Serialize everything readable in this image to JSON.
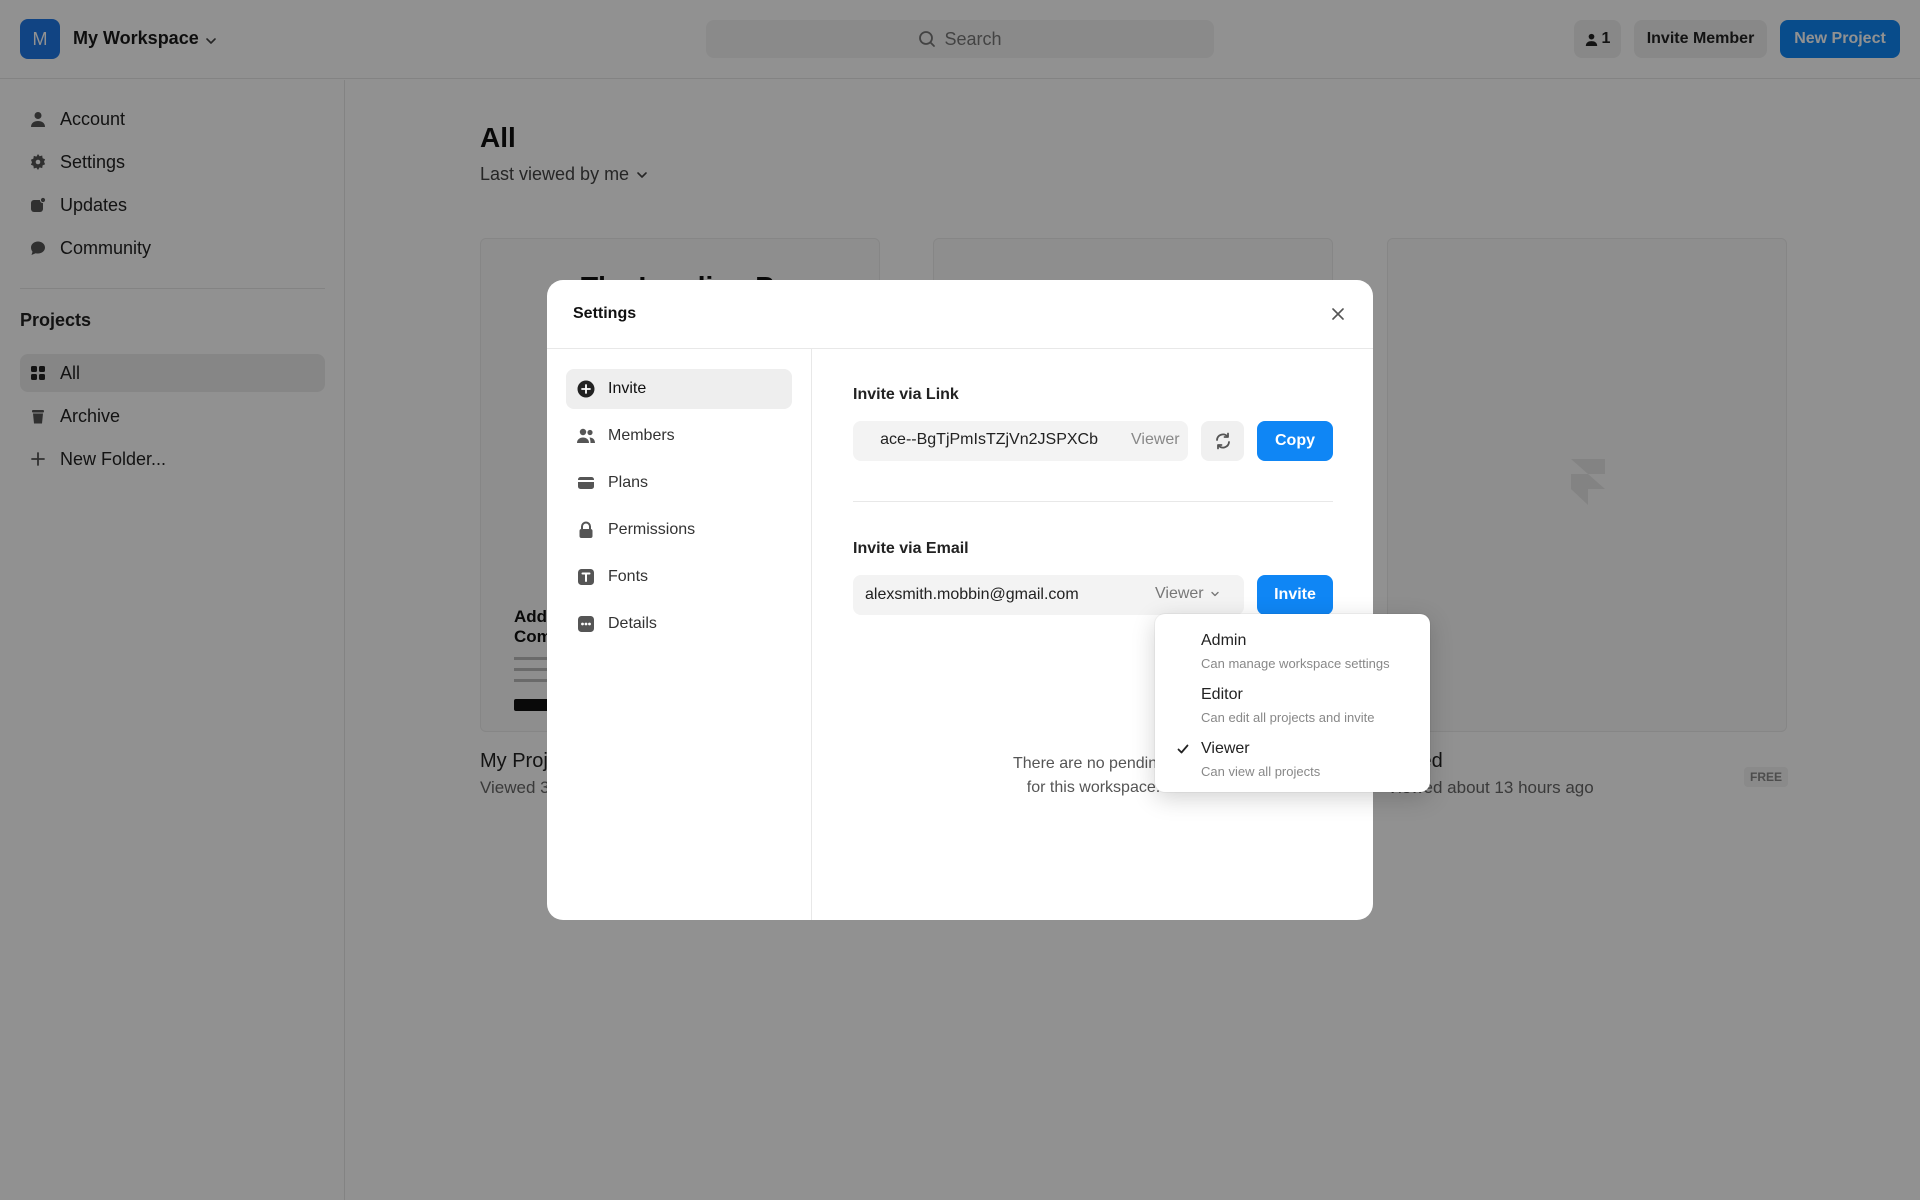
{
  "workspace": {
    "avatar_letter": "M",
    "name": "My Workspace"
  },
  "topbar": {
    "search_label": "Search",
    "member_count": "1",
    "invite_member_label": "Invite Member",
    "new_project_label": "New Project"
  },
  "sidebar": {
    "nav": [
      {
        "label": "Account",
        "icon": "person-icon"
      },
      {
        "label": "Settings",
        "icon": "gear-icon"
      },
      {
        "label": "Updates",
        "icon": "updates-icon"
      },
      {
        "label": "Community",
        "icon": "chat-bubble-icon"
      }
    ],
    "projects_title": "Projects",
    "projects": [
      {
        "label": "All",
        "icon": "grid-icon",
        "active": true
      },
      {
        "label": "Archive",
        "icon": "trash-icon",
        "active": false
      },
      {
        "label": "New Folder...",
        "icon": "plus-icon",
        "active": false
      }
    ]
  },
  "main": {
    "title": "All",
    "sort_label": "Last viewed by me",
    "cards": [
      {
        "title": "My Proj",
        "subtitle": "Viewed 3",
        "thumb_title": "The Landing P",
        "thumb_heading": "Add\nCom"
      },
      {
        "title": "",
        "subtitle": ""
      },
      {
        "title": "led",
        "subtitle": "Viewed about 13 hours ago",
        "badge": "FREE"
      }
    ]
  },
  "modal": {
    "title": "Settings",
    "nav": [
      {
        "label": "Invite",
        "icon": "plus-circle-icon",
        "active": true
      },
      {
        "label": "Members",
        "icon": "people-icon",
        "active": false
      },
      {
        "label": "Plans",
        "icon": "card-icon",
        "active": false
      },
      {
        "label": "Permissions",
        "icon": "lock-icon",
        "active": false
      },
      {
        "label": "Fonts",
        "icon": "font-icon",
        "active": false
      },
      {
        "label": "Details",
        "icon": "dots-icon",
        "active": false
      }
    ],
    "invite_link": {
      "label": "Invite via Link",
      "url_visible": "ace--BgTjPmIsTZjVn2JSPXCb",
      "role": "Viewer",
      "copy_label": "Copy"
    },
    "invite_email": {
      "label": "Invite via Email",
      "value": "alexsmith.mobbin@gmail.com",
      "role": "Viewer",
      "invite_label": "Invite"
    },
    "empty_state": "There are no pending i\nfor this workspace."
  },
  "role_dropdown": {
    "options": [
      {
        "label": "Admin",
        "description": "Can manage workspace settings",
        "selected": false
      },
      {
        "label": "Editor",
        "description": "Can edit all projects and invite",
        "selected": false
      },
      {
        "label": "Viewer",
        "description": "Can view all projects",
        "selected": true
      }
    ]
  },
  "colors": {
    "accent": "#0f86f5",
    "avatar": "#1f78e6",
    "overlay": "rgba(0,0,0,0.43)"
  }
}
